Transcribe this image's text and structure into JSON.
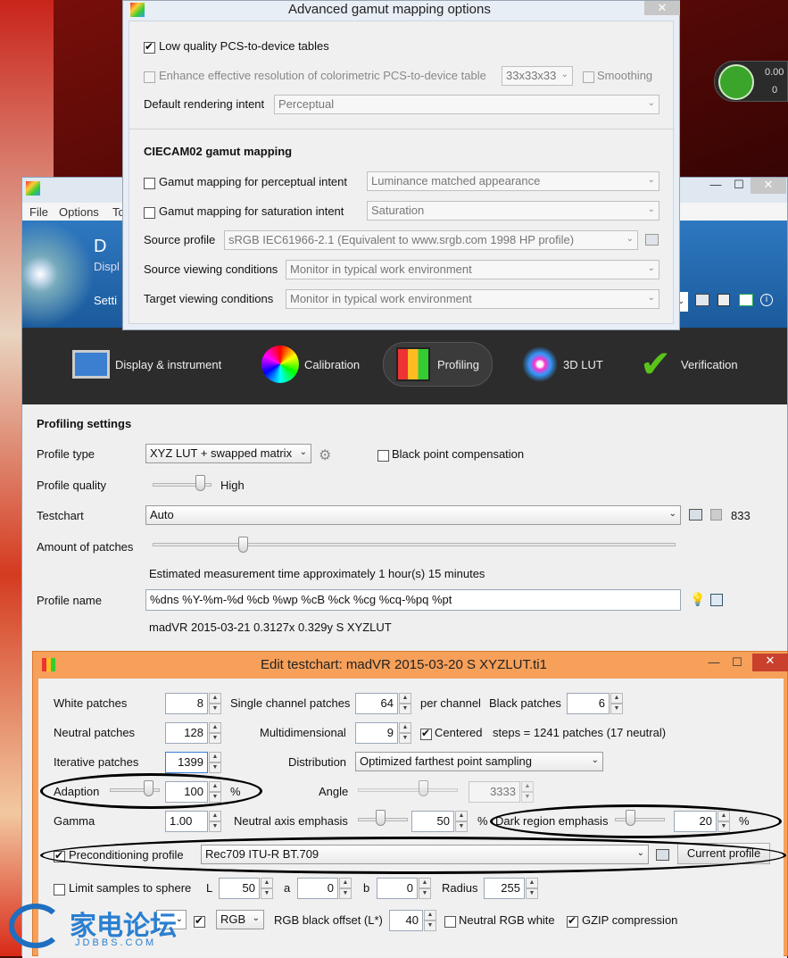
{
  "colors": {
    "accent_blue": "#2a6fb5",
    "tabbar": "#2c2c2c",
    "edit_frame": "#f6a05a",
    "check_green": "#59c41a"
  },
  "gamut_dialog": {
    "title": "Advanced gamut mapping options",
    "low_quality_label": "Low quality PCS-to-device tables",
    "enhance_label": "Enhance effective resolution of colorimetric PCS-to-device table",
    "enhance_select": "33x33x33",
    "smoothing_label": "Smoothing",
    "default_intent_label": "Default rendering intent",
    "default_intent_value": "Perceptual",
    "ciecam_title": "CIECAM02 gamut mapping",
    "perceptual_label": "Gamut mapping for perceptual intent",
    "perceptual_value": "Luminance matched appearance",
    "saturation_label": "Gamut mapping for saturation intent",
    "saturation_value": "Saturation",
    "source_profile_label": "Source profile",
    "source_profile_value": "sRGB IEC61966-2.1 (Equivalent to www.srgb.com 1998 HP profile)",
    "source_view_label": "Source viewing conditions",
    "source_view_value": "Monitor in typical work environment",
    "target_view_label": "Target viewing conditions",
    "target_view_value": "Monitor in typical work environment"
  },
  "main": {
    "menu": [
      "File",
      "Options",
      "To"
    ],
    "header_title": "D",
    "header_sub": "Displ",
    "header_settings": "Setti",
    "tabs": [
      "Display & instrument",
      "Calibration",
      "Profiling",
      "3D LUT",
      "Verification"
    ],
    "section_title": "Profiling settings",
    "profile_type_label": "Profile type",
    "profile_type_value": "XYZ LUT + swapped matrix",
    "bpc_label": "Black point compensation",
    "profile_quality_label": "Profile quality",
    "profile_quality_value": "High",
    "testchart_label": "Testchart",
    "testchart_value": "Auto",
    "testchart_count": "833",
    "patches_label": "Amount of patches",
    "estimated": "Estimated measurement time approximately 1 hour(s) 15 minutes",
    "profile_name_label": "Profile name",
    "profile_name_value": "%dns %Y-%m-%d %cb %wp %cB %ck %cg %cq-%pq %pt",
    "profile_name_result": "madVR 2015-03-21 0.3127x 0.329y S XYZLUT"
  },
  "edit": {
    "title": "Edit testchart: madVR 2015-03-20 S XYZLUT.ti1",
    "white_label": "White patches",
    "white_value": "8",
    "single_label": "Single channel patches",
    "single_value": "64",
    "per_channel": "per channel",
    "black_label": "Black patches",
    "black_value": "6",
    "neutral_label": "Neutral patches",
    "neutral_value": "128",
    "multi_label": "Multidimensional",
    "multi_value": "9",
    "centered_label": "Centered",
    "steps_text": "steps = 1241 patches (17 neutral)",
    "iter_label": "Iterative patches",
    "iter_value": "1399",
    "dist_label": "Distribution",
    "dist_value": "Optimized farthest point sampling",
    "adaption_label": "Adaption",
    "adaption_value": "100",
    "pct": "%",
    "angle_label": "Angle",
    "angle_value": "3333",
    "gamma_label": "Gamma",
    "gamma_value": "1.00",
    "neutral_axis_label": "Neutral axis emphasis",
    "neutral_axis_value": "50",
    "dark_label": "Dark region emphasis",
    "dark_value": "20",
    "precond_label": "Preconditioning profile",
    "precond_value": "Rec709 ITU-R BT.709",
    "current_profile": "Current profile",
    "limit_label": "Limit samples to sphere",
    "L_label": "L",
    "L_value": "50",
    "a_label": "a",
    "a_value": "0",
    "b_label": "b",
    "b_value": "0",
    "radius_label": "Radius",
    "radius_value": "255",
    "rgb_value": "RGB",
    "rgb_black_label": "RGB black offset (L*)",
    "rgb_black_value": "40",
    "neutral_rgb_label": "Neutral RGB white",
    "gzip_label": "GZIP compression"
  },
  "tray": {
    "line1": "0.00",
    "line2": "0"
  },
  "watermark": {
    "cn": "家电论坛",
    "en": "JDBBS.COM"
  }
}
